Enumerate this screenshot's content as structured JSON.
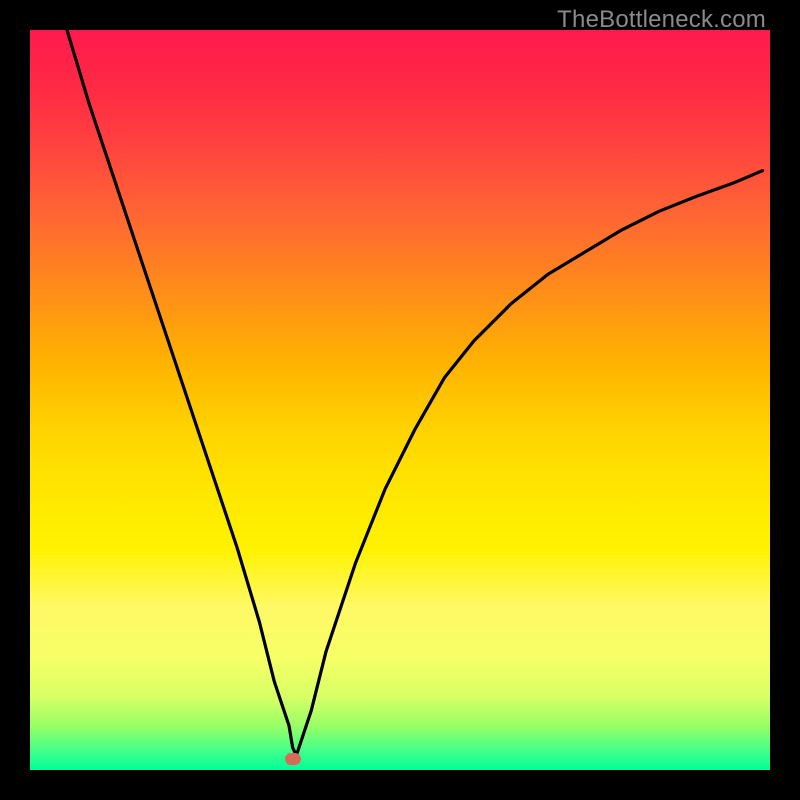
{
  "watermark": "TheBottleneck.com",
  "chart_data": {
    "type": "line",
    "title": "",
    "xlabel": "",
    "ylabel": "",
    "xlim": [
      0,
      100
    ],
    "ylim": [
      0,
      100
    ],
    "grid": false,
    "curve": {
      "x": [
        5,
        8,
        12,
        16,
        20,
        24,
        28,
        31,
        33,
        35,
        35.5,
        36,
        38,
        40,
        44,
        48,
        52,
        56,
        60,
        65,
        70,
        75,
        80,
        85,
        90,
        95,
        99
      ],
      "y": [
        100,
        90,
        78,
        66,
        54,
        42,
        30,
        20,
        12,
        6,
        3,
        2,
        8,
        16,
        28,
        38,
        46,
        53,
        58,
        63,
        67,
        70,
        73,
        75.5,
        77.5,
        79.3,
        81
      ]
    },
    "marker": {
      "x": 35.5,
      "y": 1.5,
      "color": "#d86a5a"
    },
    "gradient_stops": [
      {
        "pos": 0,
        "c": "#ff1a4d"
      },
      {
        "pos": 0.5,
        "c": "#ffd600"
      },
      {
        "pos": 0.8,
        "c": "#fff966"
      },
      {
        "pos": 1.0,
        "c": "#00ff99"
      }
    ]
  }
}
